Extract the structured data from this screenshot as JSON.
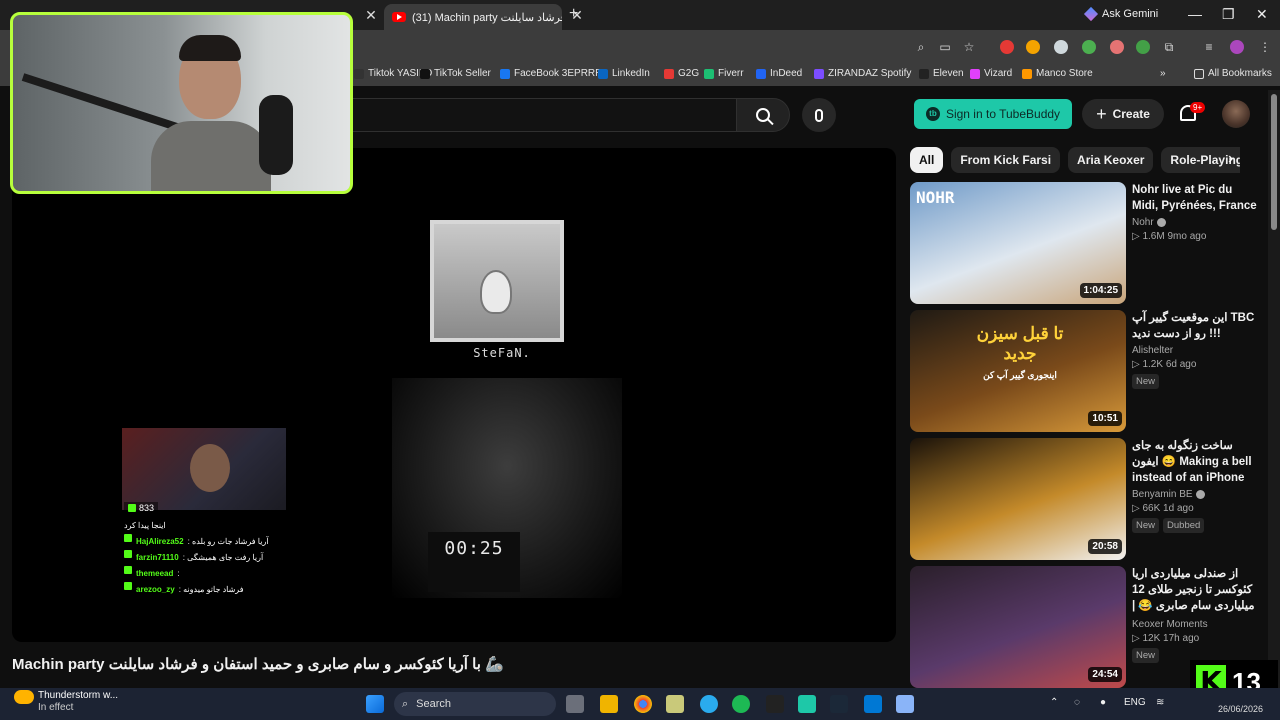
{
  "browser": {
    "active_tab_title": "(31) Machin party فرشاد سایلنت",
    "gemini_label": "Ask Gemini",
    "bookmarks": [
      {
        "label": "Tiktok YASILO",
        "color": "#333333"
      },
      {
        "label": "TikTok Seller",
        "color": "#111111"
      },
      {
        "label": "FaceBook 3EPRRR",
        "color": "#1877f2"
      },
      {
        "label": "LinkedIn",
        "color": "#0a66c2"
      },
      {
        "label": "G2G",
        "color": "#e53935"
      },
      {
        "label": "Fiverr",
        "color": "#1dbf73"
      },
      {
        "label": "InDeed",
        "color": "#2164f3"
      },
      {
        "label": "ZIRANDAZ Spotify",
        "color": "#7c4dff"
      },
      {
        "label": "Eleven",
        "color": "#222222"
      },
      {
        "label": "Vizard",
        "color": "#e040fb"
      },
      {
        "label": "Manco Store",
        "color": "#ff9800"
      }
    ],
    "all_bookmarks_label": "All Bookmarks",
    "more_bookmarks": "»"
  },
  "youtube": {
    "tubebuddy_label": "Sign in to TubeBuddy",
    "create_label": "Create",
    "notification_count": "9+",
    "chips": [
      {
        "label": "All",
        "active": true
      },
      {
        "label": "From Kick Farsi",
        "active": false
      },
      {
        "label": "Aria Keoxer",
        "active": false
      },
      {
        "label": "Role-Playing",
        "active": false
      }
    ],
    "video_title": "Machin party با آریا کئوکسر و سام صابری و حمید استفان و فرشاد سایلنت 🦾"
  },
  "player": {
    "cam_label": "SteFaN.",
    "timer": "00:25",
    "viewer_count": "833",
    "chat": [
      {
        "user": "",
        "text": "اینجا پیدا کرد"
      },
      {
        "user": "HajAlireza52",
        "text": ": آریا فرشاد جات رو بلده"
      },
      {
        "user": "farzin71110",
        "text": ": آریا رفت جای همیشگی"
      },
      {
        "user": "themeead",
        "text": ":"
      },
      {
        "user": "arezoo_zy",
        "text": ": فرشاد جاتو میدونه"
      }
    ]
  },
  "recommendations": [
    {
      "title": "Nohr live at Pic du Midi, Pyrénées, France",
      "channel": "Nohr",
      "verified": true,
      "views": "1.6M",
      "age": "9mo ago",
      "duration": "1:04:25",
      "badges": [],
      "thumb_text": "NOHR",
      "thumb_colors": [
        "#6f9ac8",
        "#dfe7ef",
        "#c9a57a"
      ]
    },
    {
      "title": "این موقعیت گییر آپ TBC رو از دست ندید !!!",
      "channel": "Alishelter",
      "verified": false,
      "views": "1.2K",
      "age": "6d ago",
      "duration": "10:51",
      "badges": [
        "New"
      ],
      "thumb_text": "تا قبل سیزن جدید",
      "thumb_sub": "اینجوری گییر آپ کن",
      "thumb_colors": [
        "#1f1a14",
        "#7a4a1a",
        "#d89a3a"
      ]
    },
    {
      "title": "ساخت زنگوله به جای ایفون 😄 Making a bell instead of an iPhone",
      "channel": "Benyamin BE",
      "verified": true,
      "views": "66K",
      "age": "1d ago",
      "duration": "20:58",
      "badges": [
        "New",
        "Dubbed"
      ],
      "thumb_colors": [
        "#1a120a",
        "#c48a2a",
        "#f1f1f1"
      ]
    },
    {
      "title": "از صندلی میلیاردی اریا کئوکسر تا زنجیر طلای 12 میلیاردی سام صابری 😂 | هایلایت استریم ...",
      "channel": "Keoxer Moments",
      "verified": false,
      "views": "12K",
      "age": "17h ago",
      "duration": "24:54",
      "badges": [
        "New"
      ],
      "thumb_colors": [
        "#2a1f2a",
        "#5a3a6a",
        "#c04a4a"
      ]
    }
  ],
  "taskbar": {
    "weather_title": "Thunderstorm w...",
    "weather_sub": "In effect",
    "search_label": "Search",
    "language": "ENG",
    "date": "26/06/2026",
    "kick_count": "13"
  }
}
